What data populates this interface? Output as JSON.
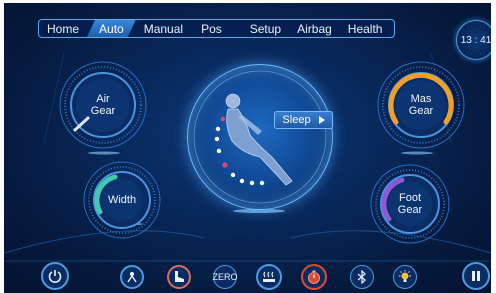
{
  "nav": {
    "tabs": [
      {
        "label": "Home"
      },
      {
        "label": "Auto"
      },
      {
        "label": "Manual"
      },
      {
        "label": "Pos"
      },
      {
        "label": "Setup"
      },
      {
        "label": "Airbag"
      },
      {
        "label": "Health"
      }
    ],
    "active_tab": "Auto"
  },
  "clock": {
    "time": "13 : 41"
  },
  "dials": {
    "air_gear": {
      "label": "Air\nGear",
      "accent": "#d8e6f5"
    },
    "width": {
      "label": "Width",
      "accent": "#3ec9b0"
    },
    "mas_gear": {
      "label": "Mas\nGear",
      "accent": "#f0a02a"
    },
    "foot_gear": {
      "label": "Foot\nGear",
      "accent": "#8a58d8"
    }
  },
  "center": {
    "program_button": {
      "label": "Sleep",
      "icon": "play-triangle-icon"
    },
    "figure_icon": "massage-chair-figure-icon"
  },
  "bottom_bar": {
    "power_icon": "power-icon",
    "items": [
      {
        "icon": "body-scan-icon"
      },
      {
        "icon": "foot-roller-icon"
      },
      {
        "label": "ZERO",
        "icon": "zero-gravity-icon"
      },
      {
        "icon": "heat-icon"
      },
      {
        "icon": "timer-icon"
      },
      {
        "icon": "bluetooth-icon"
      },
      {
        "icon": "light-bulb-icon"
      }
    ],
    "pause_icon": "pause-icon"
  },
  "colors": {
    "background": "#082a5e",
    "nav_active": "#2f78c9",
    "accent_blue": "#4d9be0",
    "heat_red": "#e0462a",
    "timer_red": "#e04a2c"
  }
}
